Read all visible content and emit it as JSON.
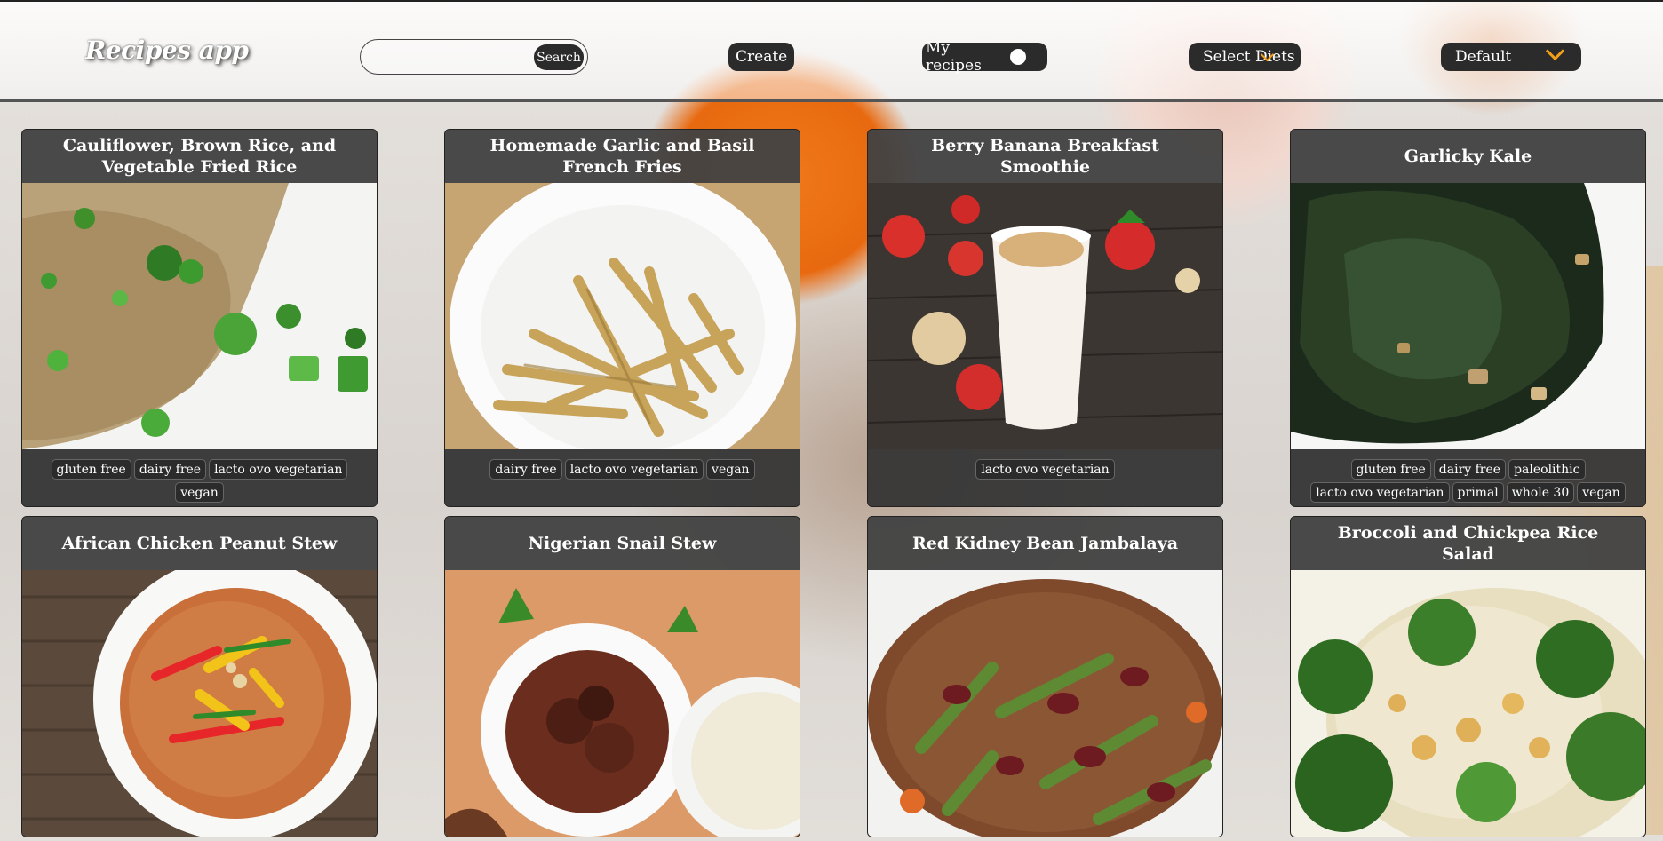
{
  "app": {
    "title": "Recipes app"
  },
  "header": {
    "search_placeholder": "",
    "search_label": "Search",
    "create_label": "Create",
    "my_recipes_label": "My recipes",
    "diets_label": "Select Diets",
    "sort_label": "Default",
    "accent_color": "#f2a019"
  },
  "recipes": [
    {
      "title": "Cauliflower, Brown Rice, and Vegetable Fried Rice",
      "tags": [
        "gluten free",
        "dairy free",
        "lacto ovo vegetarian",
        "vegan"
      ]
    },
    {
      "title": "Homemade Garlic and Basil French Fries",
      "tags": [
        "dairy free",
        "lacto ovo vegetarian",
        "vegan"
      ]
    },
    {
      "title": "Berry Banana Breakfast Smoothie",
      "tags": [
        "lacto ovo vegetarian"
      ]
    },
    {
      "title": "Garlicky Kale",
      "tags": [
        "gluten free",
        "dairy free",
        "paleolithic",
        "lacto ovo vegetarian",
        "primal",
        "whole 30",
        "vegan"
      ]
    },
    {
      "title": "African Chicken Peanut Stew",
      "tags": []
    },
    {
      "title": "Nigerian Snail Stew",
      "tags": []
    },
    {
      "title": "Red Kidney Bean Jambalaya",
      "tags": []
    },
    {
      "title": "Broccoli and Chickpea Rice Salad",
      "tags": []
    }
  ]
}
